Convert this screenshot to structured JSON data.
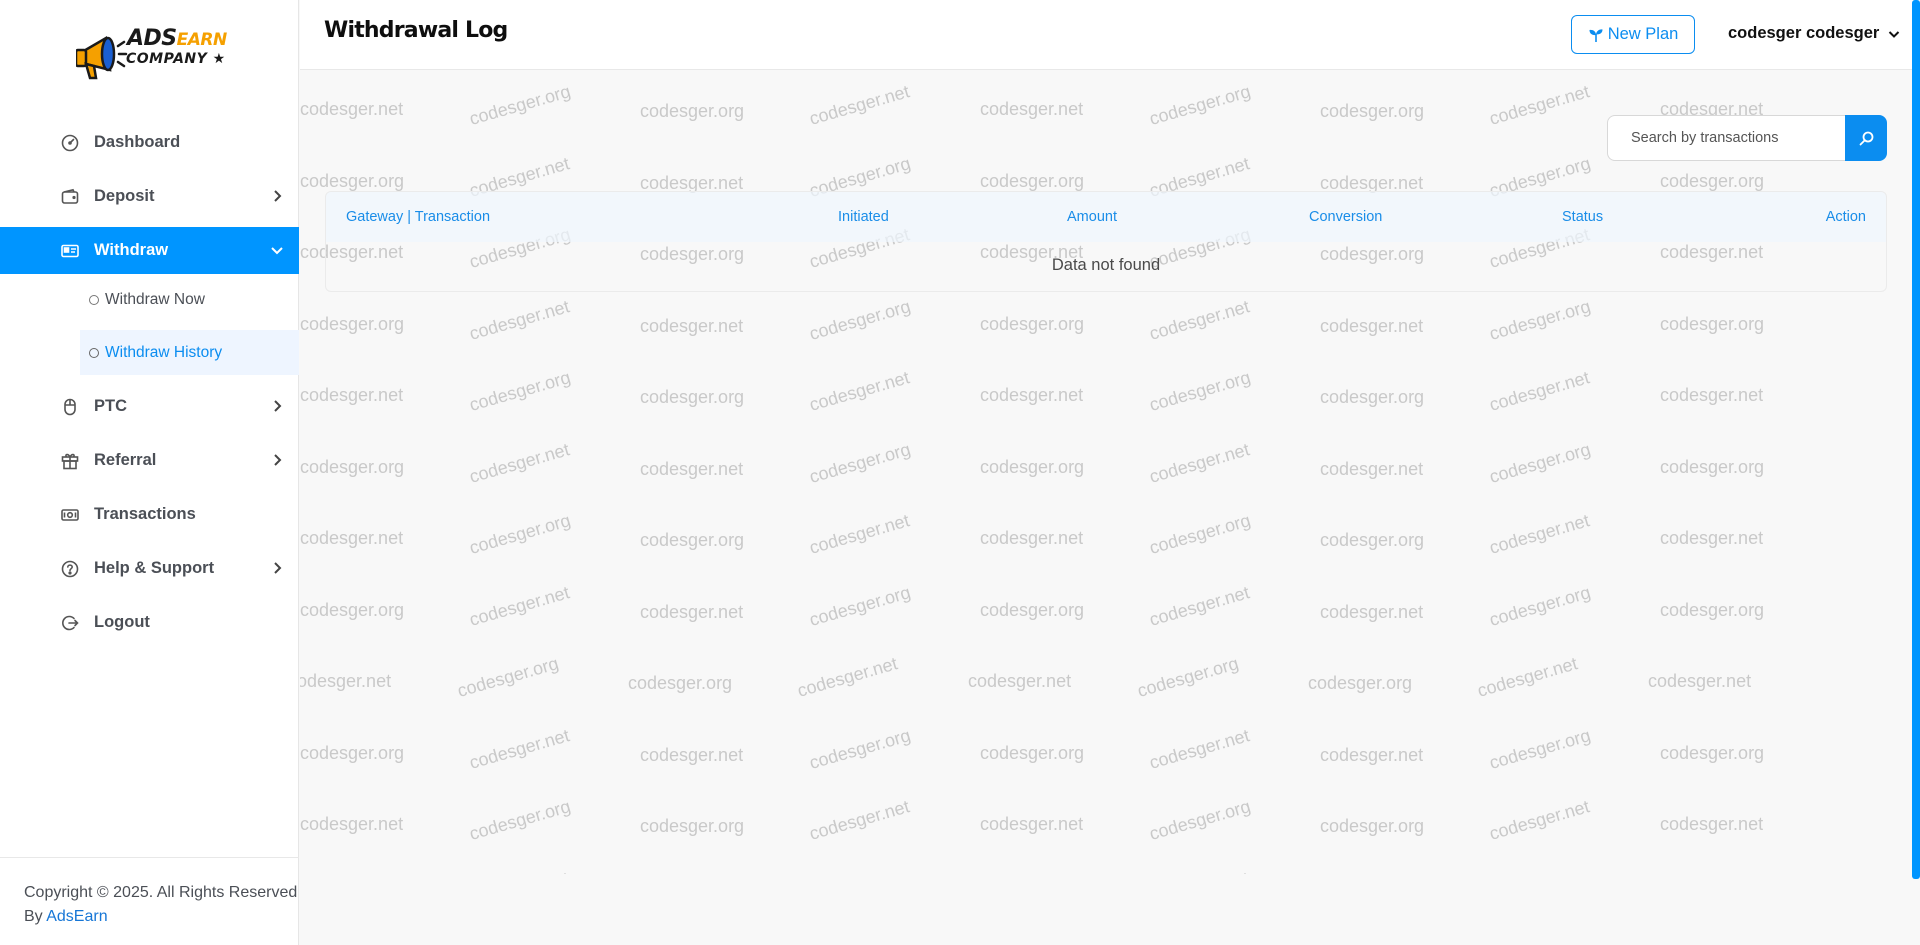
{
  "brand": {
    "logo_line1_a": "ADS",
    "logo_line1_b": "EARN",
    "logo_line2": "COMPANY ★"
  },
  "sidebar": {
    "items": [
      {
        "label": "Dashboard",
        "icon": "gauge-icon"
      },
      {
        "label": "Deposit",
        "icon": "wallet-icon",
        "has_submenu": true
      },
      {
        "label": "Withdraw",
        "icon": "cash-card-icon",
        "has_submenu": true,
        "active": true,
        "children": [
          {
            "label": "Withdraw Now"
          },
          {
            "label": "Withdraw History",
            "active": true
          }
        ]
      },
      {
        "label": "PTC",
        "icon": "mouse-icon",
        "has_submenu": true
      },
      {
        "label": "Referral",
        "icon": "gift-icon",
        "has_submenu": true
      },
      {
        "label": "Transactions",
        "icon": "money-icon"
      },
      {
        "label": "Help & Support",
        "icon": "help-circle-icon",
        "has_submenu": true
      },
      {
        "label": "Logout",
        "icon": "logout-icon"
      }
    ],
    "footer": {
      "copyright": "Copyright © 2025. All Rights Reserved By",
      "link": "AdsEarn"
    }
  },
  "header": {
    "title": "Withdrawal Log",
    "new_plan_label": "New Plan",
    "user_name": "codesger codesger"
  },
  "search": {
    "placeholder": "Search by transactions",
    "value": ""
  },
  "table": {
    "columns": [
      "Gateway | Transaction",
      "Initiated",
      "Amount",
      "Conversion",
      "Status",
      "Action"
    ],
    "empty_message": "Data not found"
  },
  "watermark": {
    "texts": [
      "codesger.net",
      "codesger.org"
    ]
  },
  "colors": {
    "accent": "#0095ff",
    "link": "#1676d6",
    "header_text": "#0e0e0e",
    "watermark": "#c9c9c9"
  }
}
